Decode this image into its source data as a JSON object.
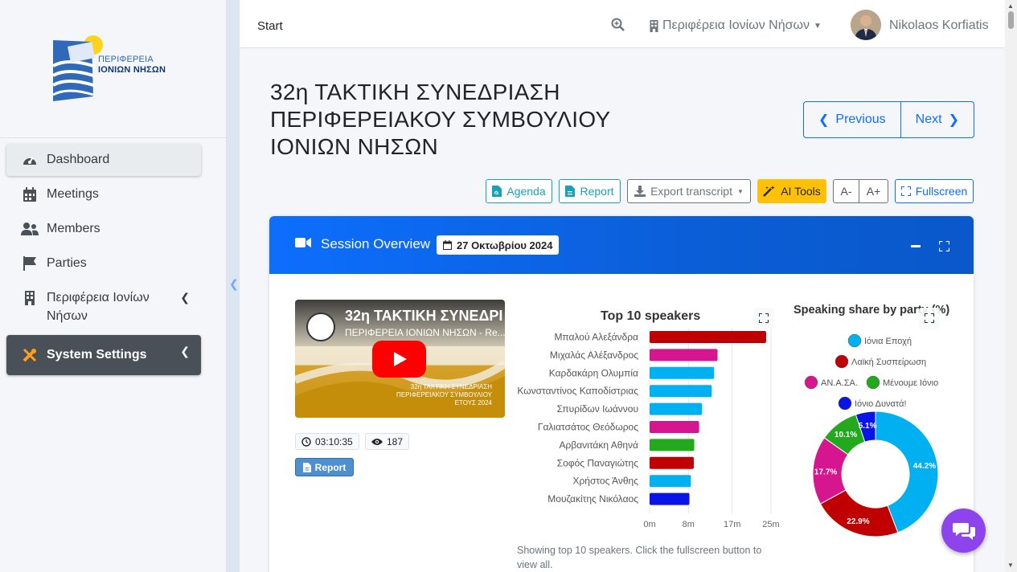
{
  "sidebar": {
    "logo": {
      "line1": "ΠΕΡΙΦΕΡΕΙΑ",
      "line2": "ΙΟΝΙΩΝ ΝΗΣΩΝ"
    },
    "items": [
      {
        "label": "Dashboard",
        "icon": "gauge-icon"
      },
      {
        "label": "Meetings",
        "icon": "calendar-icon"
      },
      {
        "label": "Members",
        "icon": "users-icon"
      },
      {
        "label": "Parties",
        "icon": "flag-icon"
      },
      {
        "label": "Περιφέρεια Ιονίων Νήσων",
        "icon": "building-icon"
      },
      {
        "label": "System Settings",
        "icon": "tools-icon"
      }
    ]
  },
  "topnav": {
    "start": "Start",
    "region": "Περιφέρεια Ιονίων Νήσων",
    "user": "Nikolaos Korfiatis"
  },
  "page": {
    "title": "32η ΤΑΚΤΙΚΗ ΣΥΝΕΔΡΙΑΣΗ ΠΕΡΙΦΕΡΕΙΑΚΟΥ ΣΥΜΒΟΥΛΙΟΥ ΙΟΝΙΩΝ ΝΗΣΩΝ",
    "previous": "Previous",
    "next": "Next"
  },
  "toolbar": {
    "agenda": "Agenda",
    "report": "Report",
    "export": "Export transcript",
    "ai": "AI Tools",
    "font_dec": "A-",
    "font_inc": "A+",
    "fullscreen": "Fullscreen"
  },
  "overview": {
    "title": "Session Overview",
    "date": "27 Οκτωβρίου 2024",
    "video_title": "32η ΤΑΚΤΙΚΗ ΣΥΝΕΔΡΙ",
    "video_subtitle": "ΠΕΡΙΦΕΡΕΙΑ ΙΟΝΙΩΝ ΝΗΣΩΝ - Re...",
    "video_caption": "32η ΤΑΚΤΙΚΗ ΣΥΝΕΔΡΙΑΣΗ ΠΕΡΙΦΕΡΕΙΑΚΟΥ ΣΥΜΒΟΥΛΙΟΥ ΕΤΟΥΣ 2024",
    "duration": "03:10:35",
    "views": "187",
    "report": "Report",
    "note": "Showing top 10 speakers. Click the fullscreen button to view all."
  },
  "colors": {
    "primary": "#0d6efd",
    "info": "#17a2b8",
    "warning": "#ffc107",
    "dark": "#495057",
    "chat": "#8e44ec"
  },
  "chart_data": [
    {
      "type": "bar",
      "orientation": "horizontal",
      "title": "Top 10 speakers",
      "categories": [
        "Μπαλού Αλεξάνδρα",
        "Μιχαλάς Αλέξανδρος",
        "Καρδακάρη Ολυμπία",
        "Κωνσταντίνος Καποδίστριας",
        "Σπυρίδων Ιωάννου",
        "Γαλιατσάτος Θεόδωρος",
        "Αρβανιτάκη Αθηνά",
        "Σοφός Παναγιώτης",
        "Χρήστος Άνθης",
        "Μουζακίτης Νικόλαος"
      ],
      "values": [
        24,
        14,
        13.3,
        12.8,
        10.8,
        10.2,
        9.2,
        9.1,
        8.5,
        8.2
      ],
      "bar_colors": [
        "#c00000",
        "#d6168e",
        "#00b0f0",
        "#00b0f0",
        "#00b0f0",
        "#d6168e",
        "#22a91e",
        "#c00000",
        "#00b0f0",
        "#0b14e6"
      ],
      "xticks": [
        "0m",
        "8m",
        "17m",
        "25m"
      ],
      "xlim": [
        0,
        25
      ],
      "grid": true
    },
    {
      "type": "pie",
      "donut": true,
      "title": "Speaking share by party (%)",
      "labels": [
        "Ιόνια Εποχή",
        "Λαϊκή Συσπείρωση",
        "ΑΝ.Α.ΣΑ.",
        "Μένουμε Ιόνιο",
        "Ιόνιο Δυνατά!"
      ],
      "values": [
        44.2,
        22.9,
        17.7,
        10.1,
        5.1
      ],
      "colors": [
        "#00b0f0",
        "#c00000",
        "#d6168e",
        "#22a91e",
        "#0b14e6"
      ],
      "legend": "top"
    }
  ]
}
